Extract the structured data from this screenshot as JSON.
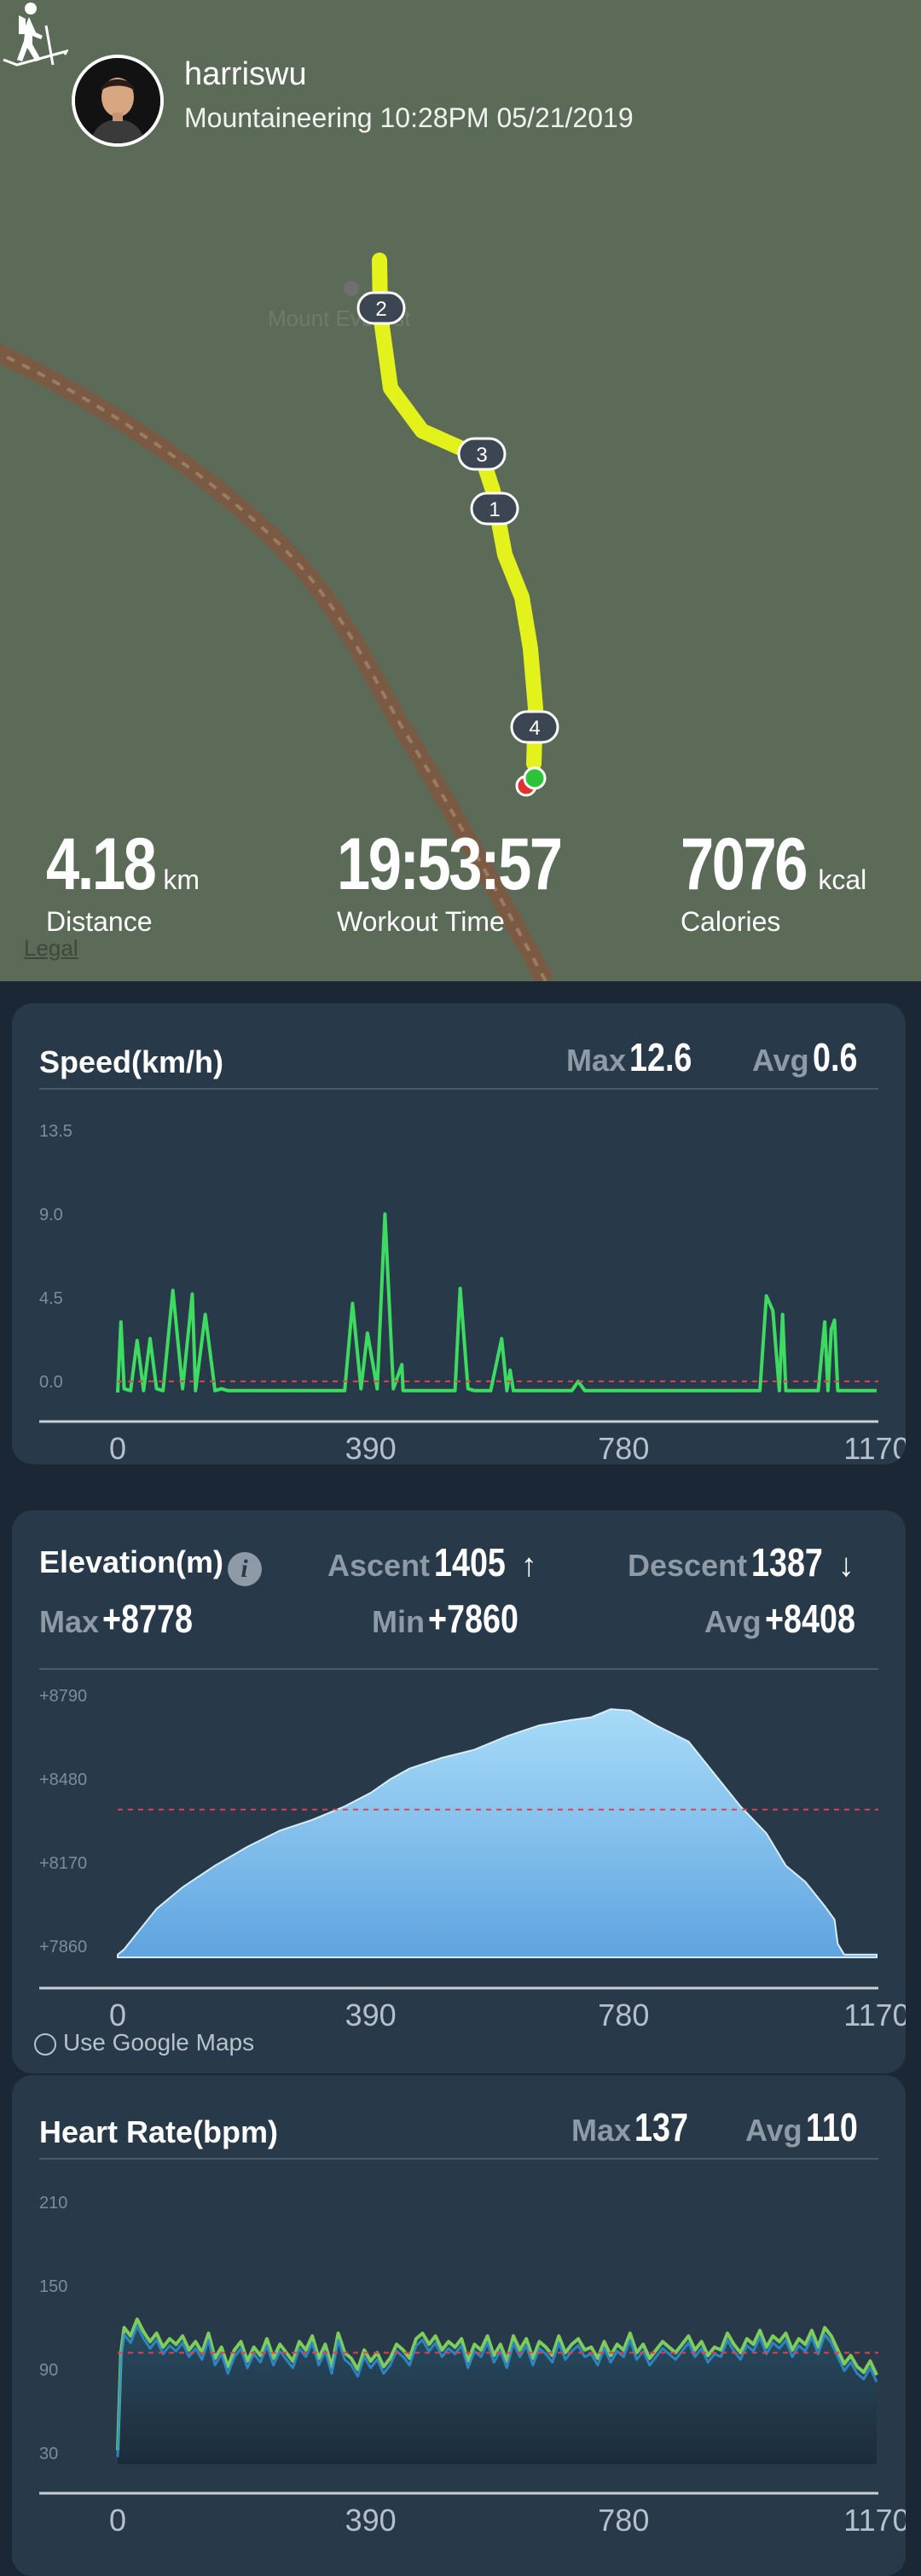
{
  "header": {
    "username": "harriswu",
    "subtitle": "Mountaineering 10:28PM 05/21/2019",
    "activity_icon": "hiker-icon"
  },
  "map": {
    "place_label": "Mount Everest",
    "legal": "Legal",
    "markers": [
      "1",
      "2",
      "3",
      "4"
    ]
  },
  "summary": {
    "distance_value": "4.18",
    "distance_unit": "km",
    "distance_label": "Distance",
    "time_value": "19:53:57",
    "time_label": "Workout Time",
    "calories_value": "7076",
    "calories_unit": "kcal",
    "calories_label": "Calories"
  },
  "speed": {
    "title": "Speed(km/h)",
    "max_label": "Max",
    "max_value": "12.6",
    "avg_label": "Avg",
    "avg_value": "0.6"
  },
  "elevation": {
    "title": "Elevation(m)",
    "ascent_label": "Ascent",
    "ascent_value": "1405",
    "descent_label": "Descent",
    "descent_value": "1387",
    "max_label": "Max",
    "max_value": "+8778",
    "min_label": "Min",
    "min_value": "+7860",
    "avg_label": "Avg",
    "avg_value": "+8408",
    "google_maps": "Use Google Maps"
  },
  "heart": {
    "title": "Heart Rate(bpm)",
    "max_label": "Max",
    "max_value": "137",
    "avg_label": "Avg",
    "avg_value": "110"
  },
  "colors": {
    "speed_line": "#3ddc60",
    "route": "#e2f21a",
    "avg_line": "#e0404f",
    "elevation_fill": "#a7dbf8",
    "heart_line": "#7ecd5a"
  },
  "chart_data": [
    {
      "type": "line",
      "title": "Speed(km/h)",
      "yticks": [
        "13.5",
        "9.0",
        "4.5",
        "0.0"
      ],
      "xticks": [
        "0",
        "390",
        "780",
        "1170"
      ],
      "ylim": [
        0,
        13.5
      ],
      "xlim": [
        0,
        1170
      ],
      "avg": 0.6,
      "x": [
        0,
        5,
        10,
        20,
        30,
        40,
        50,
        60,
        70,
        85,
        100,
        115,
        120,
        135,
        150,
        160,
        170,
        180,
        200,
        250,
        350,
        362,
        375,
        385,
        400,
        412,
        425,
        438,
        440,
        452,
        470,
        520,
        528,
        540,
        550,
        575,
        592,
        600,
        605,
        610,
        650,
        700,
        710,
        720,
        800,
        900,
        990,
        1000,
        1010,
        1020,
        1025,
        1030,
        1035,
        1040,
        1080,
        1090,
        1095,
        1100,
        1105,
        1110,
        1170
      ],
      "y": [
        0,
        3.8,
        0.2,
        0.1,
        2.8,
        0.1,
        2.9,
        0.2,
        0.1,
        5.5,
        0.2,
        5.3,
        0.1,
        4.2,
        0.1,
        0.2,
        0.1,
        0.1,
        0.1,
        0.1,
        0.1,
        4.8,
        0.2,
        3.2,
        0.2,
        9.6,
        0.2,
        1.5,
        0.1,
        0.1,
        0.1,
        0.1,
        5.6,
        0.2,
        0.1,
        0.1,
        2.9,
        0.1,
        1.2,
        0.1,
        0.1,
        0.1,
        0.6,
        0.1,
        0.1,
        0.1,
        0.1,
        5.2,
        4.4,
        0.1,
        4.2,
        0.1,
        0.1,
        0.1,
        0.1,
        3.8,
        0.1,
        3.4,
        3.9,
        0.1,
        0.1
      ]
    },
    {
      "type": "area",
      "title": "Elevation(m)",
      "yticks": [
        "+8790",
        "+8480",
        "+8170",
        "+7860"
      ],
      "xticks": [
        "0",
        "390",
        "780",
        "1170"
      ],
      "ylim": [
        7860,
        8790
      ],
      "xlim": [
        0,
        1170
      ],
      "avg": 8408,
      "x": [
        0,
        10,
        30,
        60,
        100,
        150,
        200,
        250,
        300,
        350,
        390,
        420,
        450,
        500,
        550,
        600,
        650,
        700,
        730,
        760,
        790,
        830,
        880,
        920,
        960,
        1000,
        1030,
        1060,
        1090,
        1105,
        1110,
        1120,
        1170
      ],
      "y": [
        7870,
        7890,
        7950,
        8040,
        8120,
        8200,
        8270,
        8330,
        8370,
        8420,
        8470,
        8520,
        8560,
        8600,
        8630,
        8680,
        8720,
        8740,
        8750,
        8780,
        8775,
        8720,
        8660,
        8540,
        8420,
        8320,
        8200,
        8140,
        8050,
        8000,
        7910,
        7870,
        7870
      ]
    },
    {
      "type": "line",
      "title": "Heart Rate(bpm)",
      "yticks": [
        "210",
        "150",
        "90",
        "30"
      ],
      "xticks": [
        "0",
        "390",
        "780",
        "1170"
      ],
      "ylim": [
        30,
        210
      ],
      "xlim": [
        0,
        1170
      ],
      "avg": 110,
      "x": [
        0,
        5,
        10,
        20,
        30,
        40,
        50,
        60,
        70,
        80,
        90,
        100,
        110,
        120,
        130,
        140,
        150,
        160,
        170,
        180,
        190,
        200,
        210,
        220,
        230,
        240,
        250,
        260,
        270,
        280,
        290,
        300,
        310,
        320,
        330,
        340,
        350,
        360,
        370,
        380,
        390,
        400,
        410,
        420,
        430,
        440,
        450,
        460,
        470,
        480,
        490,
        500,
        510,
        520,
        530,
        540,
        550,
        560,
        570,
        580,
        590,
        600,
        610,
        620,
        630,
        640,
        650,
        660,
        670,
        680,
        690,
        700,
        710,
        720,
        730,
        740,
        750,
        760,
        770,
        780,
        790,
        800,
        810,
        820,
        830,
        840,
        850,
        860,
        870,
        880,
        890,
        900,
        910,
        920,
        930,
        940,
        950,
        960,
        970,
        980,
        990,
        1000,
        1010,
        1020,
        1030,
        1040,
        1050,
        1060,
        1070,
        1080,
        1090,
        1100,
        1110,
        1120,
        1130,
        1140,
        1150,
        1160,
        1170
      ],
      "y": [
        40,
        110,
        128,
        122,
        134,
        125,
        118,
        124,
        114,
        120,
        116,
        122,
        112,
        118,
        110,
        124,
        106,
        114,
        100,
        112,
        118,
        104,
        114,
        108,
        120,
        106,
        116,
        110,
        104,
        118,
        112,
        122,
        106,
        116,
        100,
        124,
        110,
        106,
        98,
        112,
        104,
        110,
        100,
        106,
        116,
        112,
        106,
        120,
        124,
        116,
        122,
        112,
        118,
        114,
        120,
        104,
        116,
        112,
        122,
        108,
        116,
        104,
        122,
        112,
        120,
        106,
        118,
        114,
        108,
        122,
        110,
        116,
        120,
        112,
        114,
        106,
        118,
        108,
        116,
        112,
        124,
        110,
        116,
        106,
        112,
        118,
        114,
        110,
        116,
        122,
        112,
        118,
        108,
        114,
        112,
        124,
        116,
        110,
        120,
        116,
        126,
        114,
        122,
        118,
        124,
        112,
        120,
        116,
        126,
        114,
        128,
        122,
        112,
        102,
        108,
        100,
        96,
        104,
        94
      ]
    }
  ]
}
